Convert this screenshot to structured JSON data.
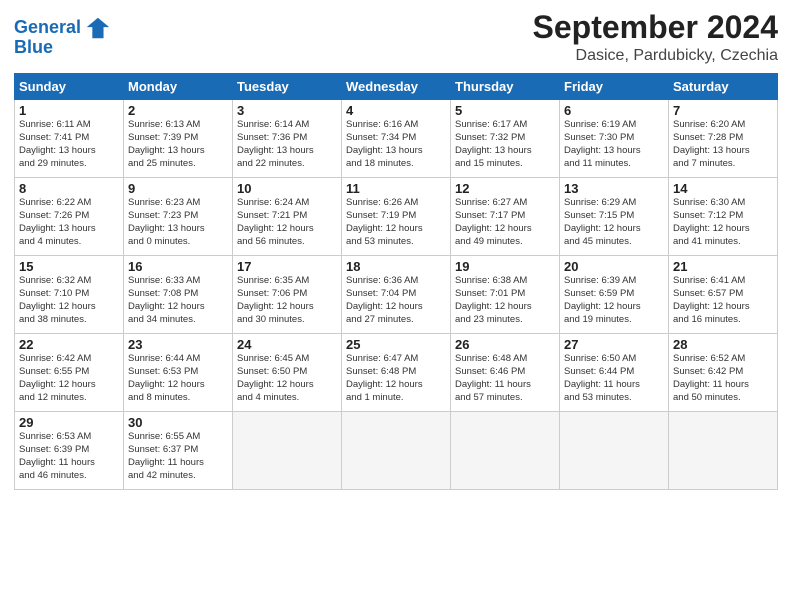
{
  "header": {
    "logo_line1": "General",
    "logo_line2": "Blue",
    "month": "September 2024",
    "location": "Dasice, Pardubicky, Czechia"
  },
  "columns": [
    "Sunday",
    "Monday",
    "Tuesday",
    "Wednesday",
    "Thursday",
    "Friday",
    "Saturday"
  ],
  "weeks": [
    [
      {
        "day": "1",
        "info": "Sunrise: 6:11 AM\nSunset: 7:41 PM\nDaylight: 13 hours\nand 29 minutes."
      },
      {
        "day": "2",
        "info": "Sunrise: 6:13 AM\nSunset: 7:39 PM\nDaylight: 13 hours\nand 25 minutes."
      },
      {
        "day": "3",
        "info": "Sunrise: 6:14 AM\nSunset: 7:36 PM\nDaylight: 13 hours\nand 22 minutes."
      },
      {
        "day": "4",
        "info": "Sunrise: 6:16 AM\nSunset: 7:34 PM\nDaylight: 13 hours\nand 18 minutes."
      },
      {
        "day": "5",
        "info": "Sunrise: 6:17 AM\nSunset: 7:32 PM\nDaylight: 13 hours\nand 15 minutes."
      },
      {
        "day": "6",
        "info": "Sunrise: 6:19 AM\nSunset: 7:30 PM\nDaylight: 13 hours\nand 11 minutes."
      },
      {
        "day": "7",
        "info": "Sunrise: 6:20 AM\nSunset: 7:28 PM\nDaylight: 13 hours\nand 7 minutes."
      }
    ],
    [
      {
        "day": "8",
        "info": "Sunrise: 6:22 AM\nSunset: 7:26 PM\nDaylight: 13 hours\nand 4 minutes."
      },
      {
        "day": "9",
        "info": "Sunrise: 6:23 AM\nSunset: 7:23 PM\nDaylight: 13 hours\nand 0 minutes."
      },
      {
        "day": "10",
        "info": "Sunrise: 6:24 AM\nSunset: 7:21 PM\nDaylight: 12 hours\nand 56 minutes."
      },
      {
        "day": "11",
        "info": "Sunrise: 6:26 AM\nSunset: 7:19 PM\nDaylight: 12 hours\nand 53 minutes."
      },
      {
        "day": "12",
        "info": "Sunrise: 6:27 AM\nSunset: 7:17 PM\nDaylight: 12 hours\nand 49 minutes."
      },
      {
        "day": "13",
        "info": "Sunrise: 6:29 AM\nSunset: 7:15 PM\nDaylight: 12 hours\nand 45 minutes."
      },
      {
        "day": "14",
        "info": "Sunrise: 6:30 AM\nSunset: 7:12 PM\nDaylight: 12 hours\nand 41 minutes."
      }
    ],
    [
      {
        "day": "15",
        "info": "Sunrise: 6:32 AM\nSunset: 7:10 PM\nDaylight: 12 hours\nand 38 minutes."
      },
      {
        "day": "16",
        "info": "Sunrise: 6:33 AM\nSunset: 7:08 PM\nDaylight: 12 hours\nand 34 minutes."
      },
      {
        "day": "17",
        "info": "Sunrise: 6:35 AM\nSunset: 7:06 PM\nDaylight: 12 hours\nand 30 minutes."
      },
      {
        "day": "18",
        "info": "Sunrise: 6:36 AM\nSunset: 7:04 PM\nDaylight: 12 hours\nand 27 minutes."
      },
      {
        "day": "19",
        "info": "Sunrise: 6:38 AM\nSunset: 7:01 PM\nDaylight: 12 hours\nand 23 minutes."
      },
      {
        "day": "20",
        "info": "Sunrise: 6:39 AM\nSunset: 6:59 PM\nDaylight: 12 hours\nand 19 minutes."
      },
      {
        "day": "21",
        "info": "Sunrise: 6:41 AM\nSunset: 6:57 PM\nDaylight: 12 hours\nand 16 minutes."
      }
    ],
    [
      {
        "day": "22",
        "info": "Sunrise: 6:42 AM\nSunset: 6:55 PM\nDaylight: 12 hours\nand 12 minutes."
      },
      {
        "day": "23",
        "info": "Sunrise: 6:44 AM\nSunset: 6:53 PM\nDaylight: 12 hours\nand 8 minutes."
      },
      {
        "day": "24",
        "info": "Sunrise: 6:45 AM\nSunset: 6:50 PM\nDaylight: 12 hours\nand 4 minutes."
      },
      {
        "day": "25",
        "info": "Sunrise: 6:47 AM\nSunset: 6:48 PM\nDaylight: 12 hours\nand 1 minute."
      },
      {
        "day": "26",
        "info": "Sunrise: 6:48 AM\nSunset: 6:46 PM\nDaylight: 11 hours\nand 57 minutes."
      },
      {
        "day": "27",
        "info": "Sunrise: 6:50 AM\nSunset: 6:44 PM\nDaylight: 11 hours\nand 53 minutes."
      },
      {
        "day": "28",
        "info": "Sunrise: 6:52 AM\nSunset: 6:42 PM\nDaylight: 11 hours\nand 50 minutes."
      }
    ],
    [
      {
        "day": "29",
        "info": "Sunrise: 6:53 AM\nSunset: 6:39 PM\nDaylight: 11 hours\nand 46 minutes."
      },
      {
        "day": "30",
        "info": "Sunrise: 6:55 AM\nSunset: 6:37 PM\nDaylight: 11 hours\nand 42 minutes."
      },
      null,
      null,
      null,
      null,
      null
    ]
  ]
}
